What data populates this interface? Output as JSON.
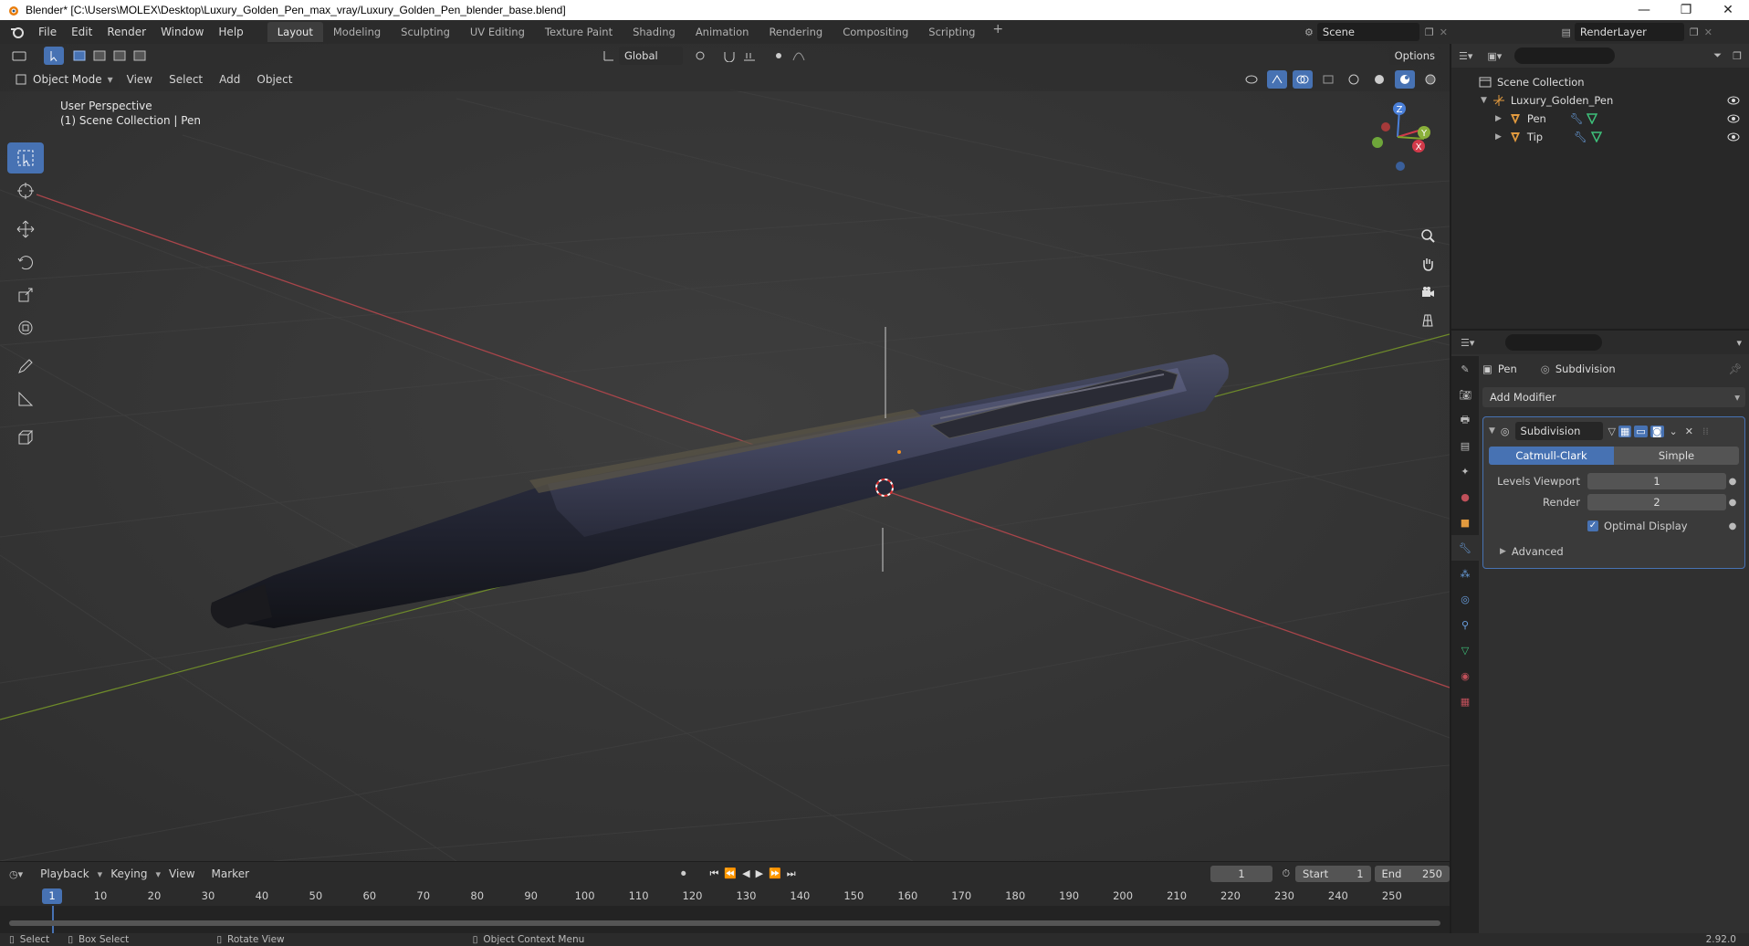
{
  "window": {
    "title": "Blender* [C:\\Users\\MOLEX\\Desktop\\Luxury_Golden_Pen_max_vray/Luxury_Golden_Pen_blender_base.blend]",
    "controls": [
      "—",
      "❐",
      "✕"
    ]
  },
  "topbar": {
    "menus": [
      "File",
      "Edit",
      "Render",
      "Window",
      "Help"
    ],
    "workspaces": [
      "Layout",
      "Modeling",
      "Sculpting",
      "UV Editing",
      "Texture Paint",
      "Shading",
      "Animation",
      "Rendering",
      "Compositing",
      "Scripting"
    ],
    "active_workspace": "Layout",
    "scene": "Scene",
    "render_layer": "RenderLayer"
  },
  "viewport": {
    "transform_orientation": "Global",
    "options_label": "Options",
    "mode": "Object Mode",
    "menus": [
      "View",
      "Select",
      "Add",
      "Object"
    ],
    "overlay_line1": "User Perspective",
    "overlay_line2": "(1) Scene Collection | Pen",
    "gizmo_axes": {
      "x": "X",
      "y": "Y",
      "z": "Z"
    },
    "colors": {
      "x_axis": "#c94b4b",
      "y_axis": "#7a9a2a",
      "accent": "#4772b3"
    }
  },
  "outliner": {
    "root": "Scene Collection",
    "collection": "Luxury_Golden_Pen",
    "objects": [
      {
        "name": "Pen"
      },
      {
        "name": "Tip"
      }
    ]
  },
  "properties": {
    "object": "Pen",
    "modifier_crumb": "Subdivision",
    "add_modifier": "Add Modifier",
    "modifier": {
      "name": "Subdivision",
      "type_options": [
        "Catmull-Clark",
        "Simple"
      ],
      "active_type": "Catmull-Clark",
      "levels_viewport_label": "Levels Viewport",
      "levels_viewport": "1",
      "render_label": "Render",
      "render": "2",
      "optimal_display_label": "Optimal Display",
      "optimal_display": true,
      "advanced_label": "Advanced"
    }
  },
  "timeline": {
    "menus": [
      "Playback",
      "Keying",
      "View",
      "Marker"
    ],
    "current_frame": "1",
    "start_label": "Start",
    "start": "1",
    "end_label": "End",
    "end": "250",
    "ruler": [
      "10",
      "20",
      "30",
      "40",
      "50",
      "60",
      "70",
      "80",
      "90",
      "100",
      "110",
      "120",
      "130",
      "140",
      "150",
      "160",
      "170",
      "180",
      "190",
      "200",
      "210",
      "220",
      "230",
      "240",
      "250"
    ]
  },
  "statusbar": {
    "select": "Select",
    "box_select": "Box Select",
    "rotate_view": "Rotate View",
    "context_menu": "Object Context Menu",
    "version": "2.92.0"
  }
}
